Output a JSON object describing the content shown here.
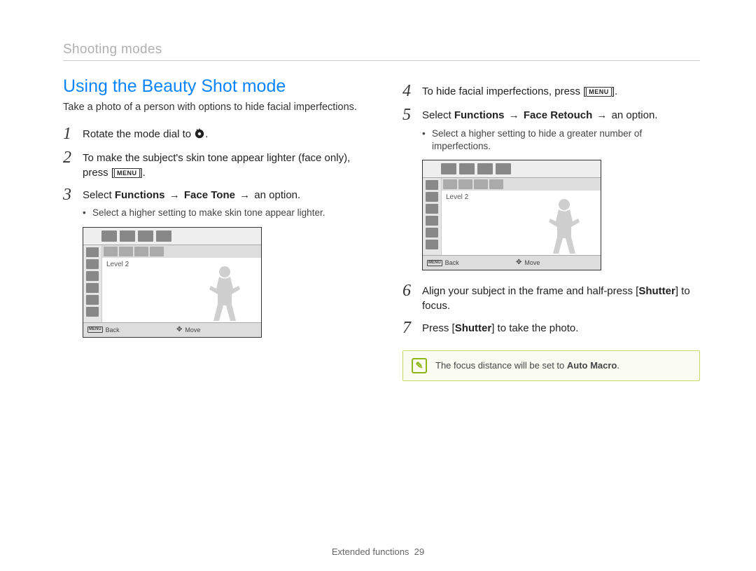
{
  "breadcrumb": "Shooting modes",
  "section_title": "Using the Beauty Shot mode",
  "lede": "Take a photo of a person with options to hide facial imperfections.",
  "steps": {
    "s1": {
      "num": "1",
      "text_pre": "Rotate the mode dial to ",
      "text_post": "."
    },
    "s2": {
      "num": "2",
      "text_pre": "To make the subject's skin tone appear lighter (face only), press [",
      "text_post": "]."
    },
    "s3": {
      "num": "3",
      "text_pre": "Select ",
      "bold1": "Functions",
      "arrow1": " → ",
      "bold2": "Face Tone",
      "arrow2": " → ",
      "text_post": "an option."
    },
    "s3_sub": "Select a higher setting to make skin tone appear lighter.",
    "s4": {
      "num": "4",
      "text_pre": "To hide facial imperfections, press [",
      "text_post": "]."
    },
    "s5": {
      "num": "5",
      "text_pre": "Select ",
      "bold1": "Functions",
      "arrow1": " → ",
      "bold2": "Face Retouch",
      "arrow2": " → ",
      "text_post": "an option."
    },
    "s5_sub": "Select a higher setting to hide a greater number of imperfections.",
    "s6": {
      "num": "6",
      "text_pre": "Align your subject in the frame and half-press [",
      "bold": "Shutter",
      "text_post": "] to focus."
    },
    "s7": {
      "num": "7",
      "text_pre": "Press [",
      "bold": "Shutter",
      "text_post": "] to take the photo."
    }
  },
  "menu_label": "MENU",
  "mock": {
    "level_label": "Level 2",
    "back_label": "Back",
    "move_label": "Move",
    "menu_small": "MENU"
  },
  "note": {
    "text_pre": "The focus distance will be set to ",
    "bold": "Auto Macro",
    "text_post": "."
  },
  "footer": {
    "section": "Extended functions",
    "page": "29"
  }
}
